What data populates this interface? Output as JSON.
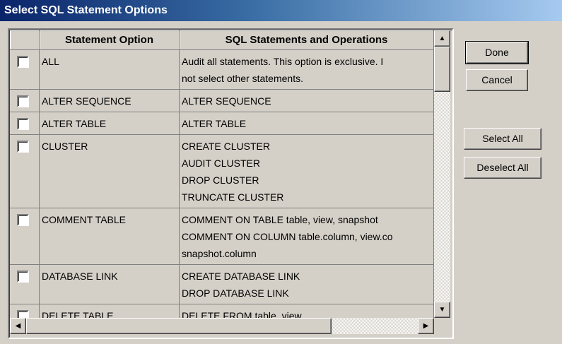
{
  "window": {
    "title": "Select SQL Statement Options"
  },
  "grid": {
    "headers": [
      "",
      "Statement Option",
      "SQL Statements and Operations"
    ],
    "rows": [
      {
        "option": "ALL",
        "lines": [
          "Audit all statements. This option is exclusive. I",
          "not select other statements."
        ]
      },
      {
        "option": "ALTER SEQUENCE",
        "lines": [
          "ALTER SEQUENCE"
        ]
      },
      {
        "option": "ALTER TABLE",
        "lines": [
          "ALTER TABLE"
        ]
      },
      {
        "option": "CLUSTER",
        "lines": [
          "CREATE CLUSTER",
          "AUDIT CLUSTER",
          "DROP CLUSTER",
          "TRUNCATE CLUSTER"
        ]
      },
      {
        "option": "COMMENT TABLE",
        "lines": [
          "COMMENT ON TABLE table, view, snapshot",
          "COMMENT ON COLUMN table.column, view.co",
          "snapshot.column"
        ]
      },
      {
        "option": "DATABASE LINK",
        "lines": [
          "CREATE DATABASE LINK",
          "DROP DATABASE LINK"
        ]
      },
      {
        "option": "DELETE TABLE",
        "lines": [
          "DELETE FROM table, view"
        ]
      }
    ]
  },
  "buttons": {
    "done": "Done",
    "cancel": "Cancel",
    "select_all": "Select All",
    "deselect_all": "Deselect All"
  },
  "icons": {
    "scroll_up": "▲",
    "scroll_down": "▼",
    "scroll_left": "◀",
    "scroll_right": "▶"
  }
}
